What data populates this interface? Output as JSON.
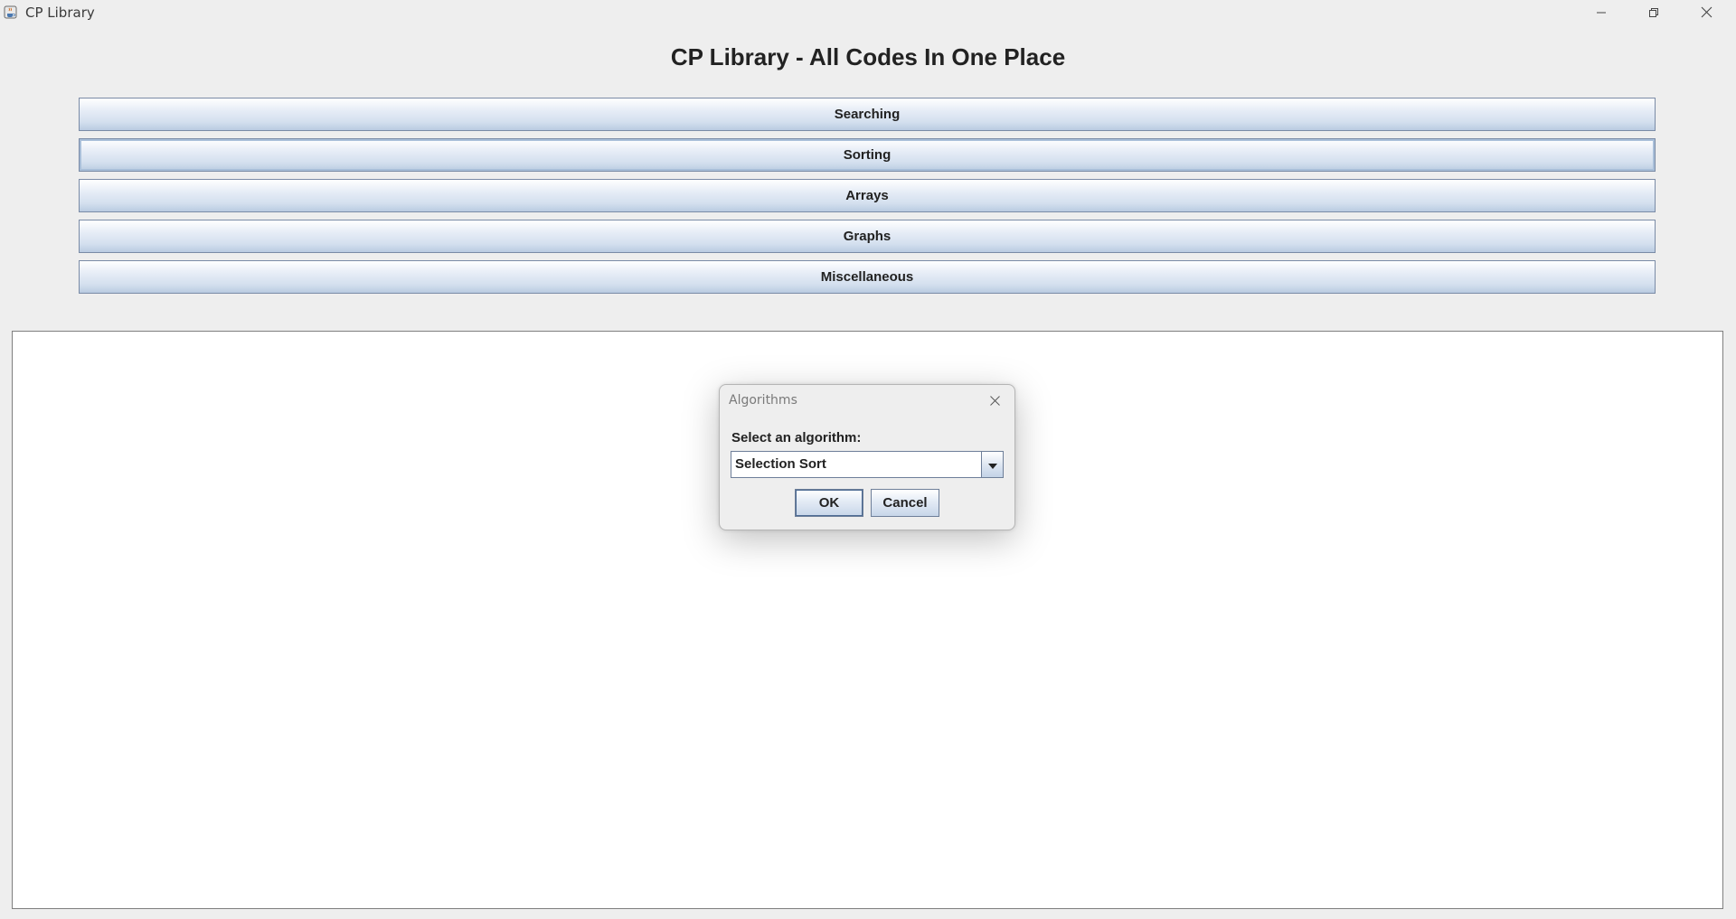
{
  "window": {
    "title": "CP Library"
  },
  "app": {
    "heading": "CP Library - All Codes In One Place",
    "categories": [
      {
        "label": "Searching"
      },
      {
        "label": "Sorting"
      },
      {
        "label": "Arrays"
      },
      {
        "label": "Graphs"
      },
      {
        "label": "Miscellaneous"
      }
    ]
  },
  "dialog": {
    "title": "Algorithms",
    "prompt": "Select an algorithm:",
    "selected_algorithm": "Selection Sort",
    "ok_label": "OK",
    "cancel_label": "Cancel"
  },
  "icons": {
    "app": "java-cup-icon",
    "minimize": "minimize-icon",
    "maximize": "restore-icon",
    "close": "close-icon",
    "dropdown": "chevron-down-icon"
  },
  "colors": {
    "window_bg": "#eeeeee",
    "button_border": "#7a8ba6",
    "content_bg": "#ffffff"
  }
}
